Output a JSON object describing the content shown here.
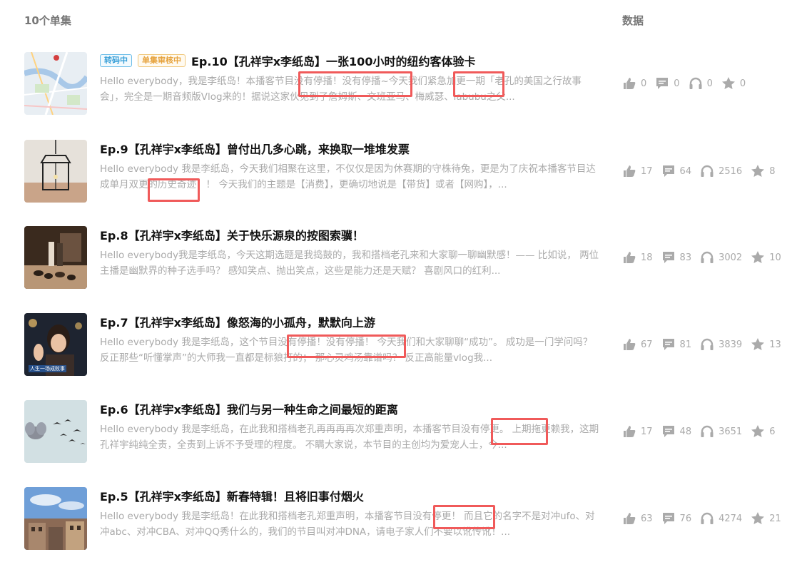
{
  "header": {
    "episodes_count": "10个单集",
    "data_label": "数据"
  },
  "colors": {
    "highlight": "#f05a5a",
    "stat": "#aaaaaa",
    "tag_blue": "#3aa0d8",
    "tag_orange": "#e6a23c"
  },
  "episodes": [
    {
      "tags": [
        "转码中",
        "单集审核中"
      ],
      "title": "Ep.10【孔祥宇x李纸岛】一张100小时的纽约客体验卡",
      "desc": "Hello everybody，我是李纸岛！本播客节目没有停播！没有停播~今天我们紧急加更一期「老孔的美国之行故事会」，完全是一期音频版Vlog来的！据说这家伙见到了詹姆斯、文班亚马、梅威瑟、labubu之父...",
      "thumb_icon": "map-thumbnail",
      "likes": "0",
      "comments": "0",
      "listens": "0",
      "stars": "0"
    },
    {
      "tags": [],
      "title": "Ep.9【孔祥宇x李纸岛】曾付出几多心跳，来换取一堆堆发票",
      "desc": "Hello everybody 我是李纸岛，今天我们相聚在这里，不仅仅是因为休赛期的守株待兔，更是为了庆祝本播客节目达成单月双更的历史奇迹！！ 今天我们的主题是【消费】，更确切地说是【带货】或者【网购】，...",
      "thumb_icon": "lamp-thumbnail",
      "likes": "17",
      "comments": "64",
      "listens": "2516",
      "stars": "8"
    },
    {
      "tags": [],
      "title": "Ep.8【孔祥宇x李纸岛】关于快乐源泉的按图索骥！",
      "desc": "Hello everybody我是李纸岛，今天这期选题是我捣鼓的，我和搭档老孔来和大家聊一聊幽默感！—— 比如说， 两位主播是幽默界的种子选手吗？ 感知笑点、抛出笑点，这些是能力还是天赋？ 喜剧风口的红利...",
      "thumb_icon": "dogs-thumbnail",
      "likes": "18",
      "comments": "83",
      "listens": "3002",
      "stars": "10"
    },
    {
      "tags": [],
      "title": "Ep.7【孔祥宇x李纸岛】像怒海的小孤舟，默默向上游",
      "desc": "Hello everybody 我是李纸岛，这个节目没有停播！没有停播！ 今天我们和大家聊聊“成功”。 成功是一门学问吗？ 反正那些“听懂掌声”的大师我一直都是标狼打的； 那心灵鸡汤靠谱吗？ 反正高能量vlog我...",
      "thumb_icon": "movie-thumbnail",
      "thumb_caption": "人生一场成败事",
      "likes": "67",
      "comments": "81",
      "listens": "3839",
      "stars": "13"
    },
    {
      "tags": [],
      "title": "Ep.6【孔祥宇x李纸岛】我们与另一种生命之间最短的距离",
      "desc": "Hello everybody 我是李纸岛，在此我和搭档老孔再再再再次郑重声明，本播客节目没有停更。 上期拖更赖我，这期孔祥宇纯纯全责，全责到上诉不予受理的程度。 不瞒大家说，本节目的主创均为爱宠人士，今...",
      "thumb_icon": "elephant-thumbnail",
      "likes": "17",
      "comments": "48",
      "listens": "3651",
      "stars": "6"
    },
    {
      "tags": [],
      "title": "Ep.5【孔祥宇x李纸岛】新春特辑！且将旧事付烟火",
      "desc": "Hello everybody 我是李纸岛！在此我和搭档老孔郑重声明，本播客节目没有停更！ 而且它的名字不是对冲ufo、对冲abc、对冲CBA、对冲QQ秀什么的，我们的节目叫对冲DNA，请电子家人们不要以讹传讹！...",
      "thumb_icon": "city-thumbnail",
      "likes": "63",
      "comments": "76",
      "listens": "4274",
      "stars": "21"
    }
  ]
}
